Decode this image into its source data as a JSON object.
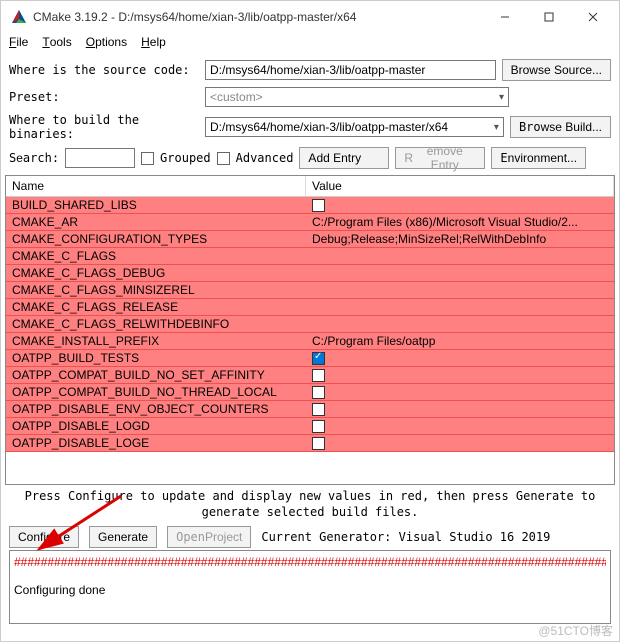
{
  "window": {
    "title": "CMake 3.19.2 - D:/msys64/home/xian-3/lib/oatpp-master/x64"
  },
  "menu": {
    "file": "File",
    "tools": "Tools",
    "options": "Options",
    "help": "Help"
  },
  "labels": {
    "source": "Where is the source code:",
    "preset": "Preset:",
    "binaries": "Where to build the binaries:",
    "search": "Search:",
    "grouped": "Grouped",
    "advanced": "Advanced"
  },
  "fields": {
    "source": "D:/msys64/home/xian-3/lib/oatpp-master",
    "preset": "<custom>",
    "binaries": "D:/msys64/home/xian-3/lib/oatpp-master/x64",
    "search": ""
  },
  "buttons": {
    "browse_source": "Browse Source...",
    "browse_build": "Browse Build...",
    "add_entry": "Add Entry",
    "remove_entry": "Remove Entry",
    "environment": "Environment...",
    "configure": "Configure",
    "generate": "Generate",
    "open_project": "Open Project"
  },
  "table": {
    "headers": {
      "name": "Name",
      "value": "Value"
    },
    "rows": [
      {
        "name": "BUILD_SHARED_LIBS",
        "type": "bool",
        "checked": false
      },
      {
        "name": "CMAKE_AR",
        "type": "text",
        "value": "C:/Program Files (x86)/Microsoft Visual Studio/2..."
      },
      {
        "name": "CMAKE_CONFIGURATION_TYPES",
        "type": "text",
        "value": "Debug;Release;MinSizeRel;RelWithDebInfo"
      },
      {
        "name": "CMAKE_C_FLAGS",
        "type": "text",
        "value": ""
      },
      {
        "name": "CMAKE_C_FLAGS_DEBUG",
        "type": "text",
        "value": ""
      },
      {
        "name": "CMAKE_C_FLAGS_MINSIZEREL",
        "type": "text",
        "value": ""
      },
      {
        "name": "CMAKE_C_FLAGS_RELEASE",
        "type": "text",
        "value": ""
      },
      {
        "name": "CMAKE_C_FLAGS_RELWITHDEBINFO",
        "type": "text",
        "value": ""
      },
      {
        "name": "CMAKE_INSTALL_PREFIX",
        "type": "text",
        "value": "C:/Program Files/oatpp"
      },
      {
        "name": "OATPP_BUILD_TESTS",
        "type": "bool",
        "checked": true
      },
      {
        "name": "OATPP_COMPAT_BUILD_NO_SET_AFFINITY",
        "type": "bool",
        "checked": false
      },
      {
        "name": "OATPP_COMPAT_BUILD_NO_THREAD_LOCAL",
        "type": "bool",
        "checked": false
      },
      {
        "name": "OATPP_DISABLE_ENV_OBJECT_COUNTERS",
        "type": "bool",
        "checked": false
      },
      {
        "name": "OATPP_DISABLE_LOGD",
        "type": "bool",
        "checked": false
      },
      {
        "name": "OATPP_DISABLE_LOGE",
        "type": "bool",
        "checked": false
      }
    ]
  },
  "hint": "Press Configure to update and display new values in red, then press Generate to generate selected build files.",
  "generator": "Current Generator: Visual Studio 16 2019",
  "log": {
    "hashes": "#########################################################################################",
    "done": "Configuring done"
  },
  "watermark": "@51CTO博客"
}
